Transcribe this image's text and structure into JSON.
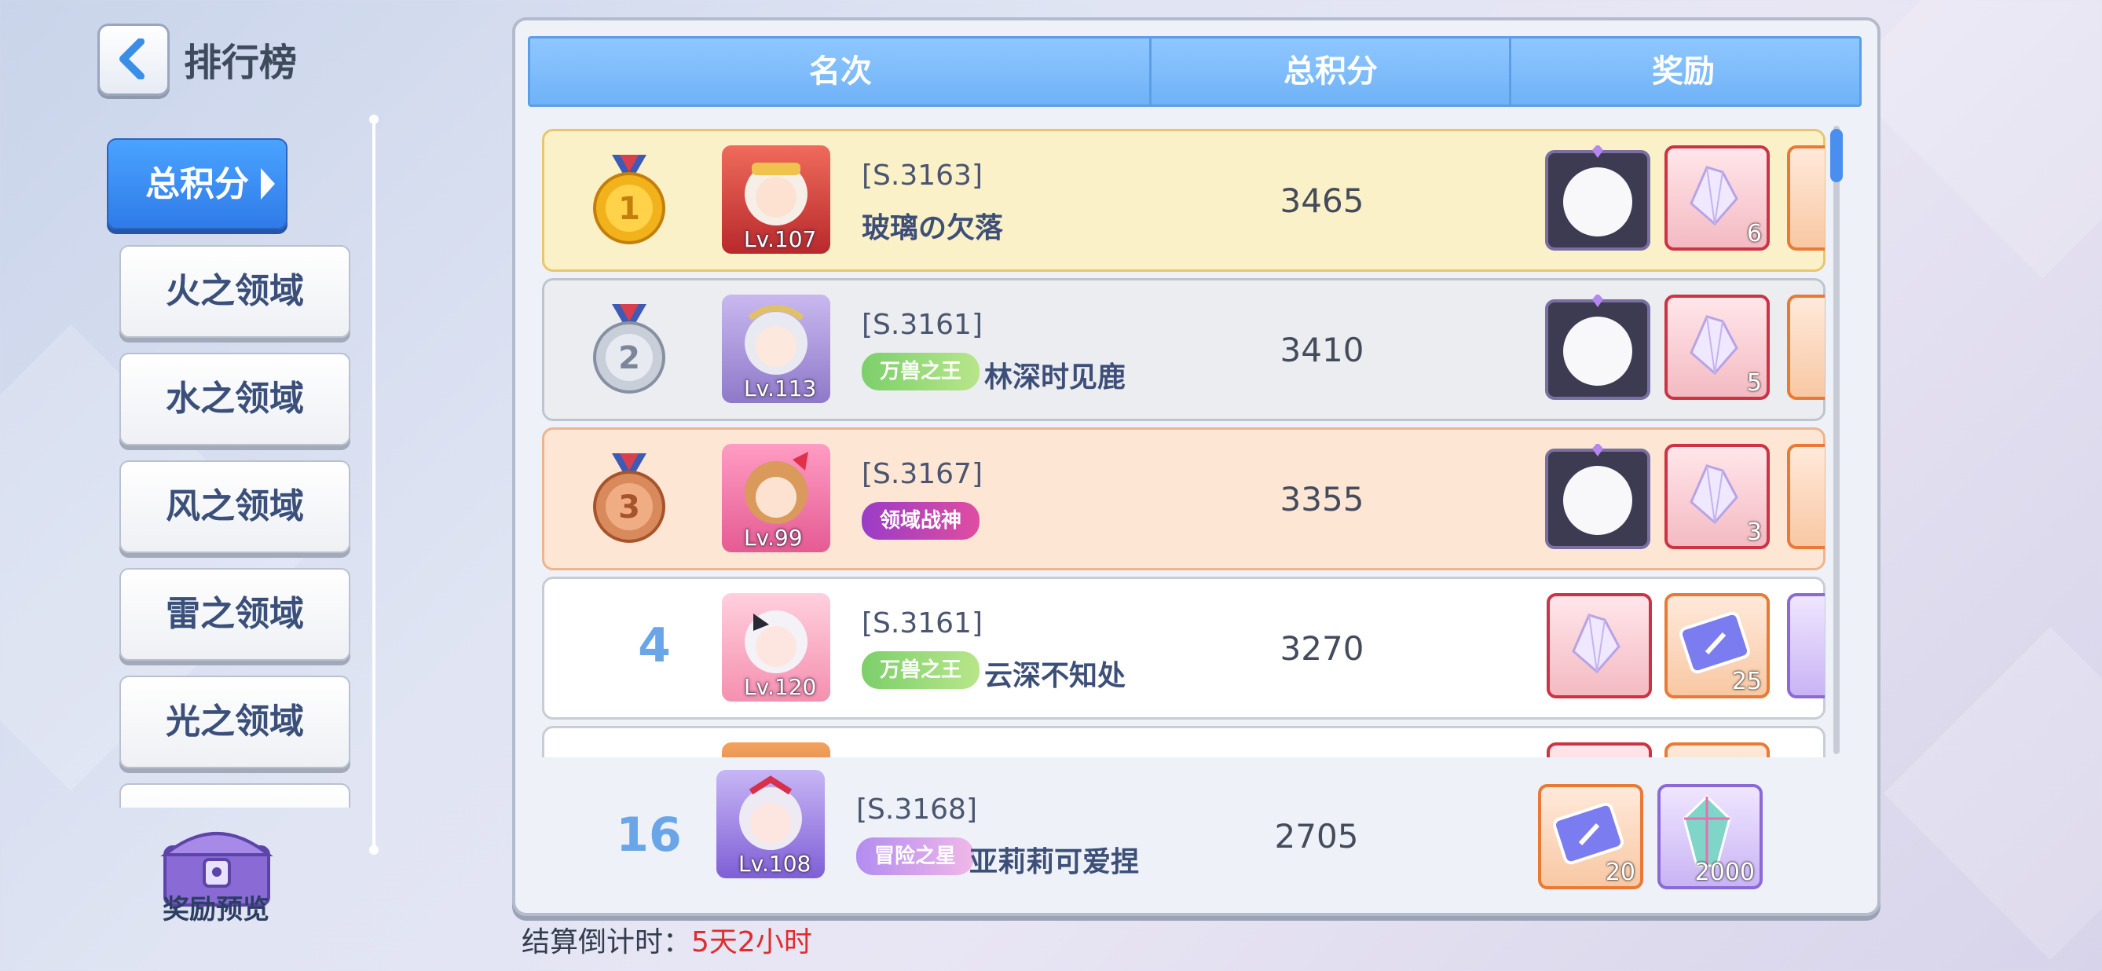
{
  "header": {
    "title": "排行榜"
  },
  "nav": {
    "items": [
      "总积分",
      "火之领域",
      "水之领域",
      "风之领域",
      "雷之领域",
      "光之领域"
    ],
    "active_index": 0
  },
  "reward_preview": {
    "label": "奖励预览"
  },
  "table": {
    "columns": [
      "名次",
      "总积分",
      "奖励"
    ],
    "rows": [
      {
        "rank": "1",
        "server": "[S.3163]",
        "name": "玻璃の欠落",
        "level": "Lv.107",
        "score": "3465",
        "rewards": [
          {
            "icon": "frame-icon",
            "qty": ""
          },
          {
            "icon": "crystal-icon",
            "qty": "6"
          }
        ]
      },
      {
        "rank": "2",
        "server": "[S.3161]",
        "name": "林深时见鹿",
        "title_badge": "万兽之王",
        "level": "Lv.113",
        "score": "3410",
        "rewards": [
          {
            "icon": "frame-icon",
            "qty": ""
          },
          {
            "icon": "crystal-icon",
            "qty": "5"
          }
        ]
      },
      {
        "rank": "3",
        "server": "[S.3167]",
        "name": "",
        "title_badge": "领域战神",
        "level": "Lv.99",
        "score": "3355",
        "rewards": [
          {
            "icon": "frame-icon",
            "qty": ""
          },
          {
            "icon": "crystal-icon",
            "qty": "3"
          }
        ]
      },
      {
        "rank": "4",
        "server": "[S.3161]",
        "name": "云深不知处",
        "title_badge": "万兽之王",
        "level": "Lv.120",
        "score": "3270",
        "rewards": [
          {
            "icon": "crystal-icon",
            "qty": ""
          },
          {
            "icon": "ticket-icon",
            "qty": "25"
          }
        ]
      }
    ]
  },
  "self_row": {
    "rank": "16",
    "server": "[S.3168]",
    "name": "亚莉莉可爱捏",
    "title_badge": "冒险之星",
    "level": "Lv.108",
    "score": "2705",
    "rewards": [
      {
        "icon": "ticket-icon",
        "qty": "20"
      },
      {
        "icon": "gem-icon",
        "qty": "2000"
      }
    ]
  },
  "countdown": {
    "label": "结算倒计时：",
    "value": "5天2小时"
  },
  "colors": {
    "header_blue": "#7bbcf9",
    "gold_row": "#fbf1c8",
    "silver_row": "#ebedf1",
    "bronze_row": "#fde6d4",
    "countdown_red": "#e02c2c"
  }
}
